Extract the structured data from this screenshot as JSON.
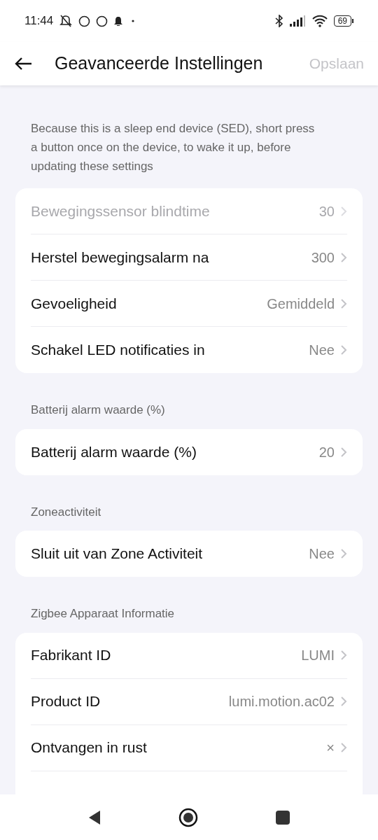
{
  "status_bar": {
    "time": "11:44",
    "battery": "69"
  },
  "header": {
    "title": "Geavanceerde Instellingen",
    "save": {
      "label": "Opslaan",
      "disabled": true
    }
  },
  "notice": "Because this is a sleep end device (SED), short press a button once on the device, to wake it up, before updating these settings",
  "sections": [
    {
      "rows": [
        {
          "label": "Bewegingssensor blindtime",
          "value": "30",
          "disabled": true
        },
        {
          "label": "Herstel bewegingsalarm na",
          "value": "300",
          "disabled": false
        },
        {
          "label": "Gevoeligheid",
          "value": "Gemiddeld",
          "disabled": false
        },
        {
          "label": "Schakel LED notificaties in",
          "value": "Nee",
          "disabled": false
        }
      ]
    },
    {
      "title": "Batterij alarm waarde (%)",
      "rows": [
        {
          "label": "Batterij alarm waarde (%)",
          "value": "20",
          "disabled": false
        }
      ]
    },
    {
      "title": "Zoneactiviteit",
      "rows": [
        {
          "label": "Sluit uit van Zone Activiteit",
          "value": "Nee",
          "disabled": false
        }
      ]
    },
    {
      "title": "Zigbee Apparaat Informatie",
      "rows": [
        {
          "label": "Fabrikant ID",
          "value": "LUMI",
          "disabled": false
        },
        {
          "label": "Product ID",
          "value": "lumi.motion.ac02",
          "disabled": false
        },
        {
          "label": "Ontvangen in rust",
          "value": "×",
          "disabled": false
        }
      ]
    }
  ]
}
